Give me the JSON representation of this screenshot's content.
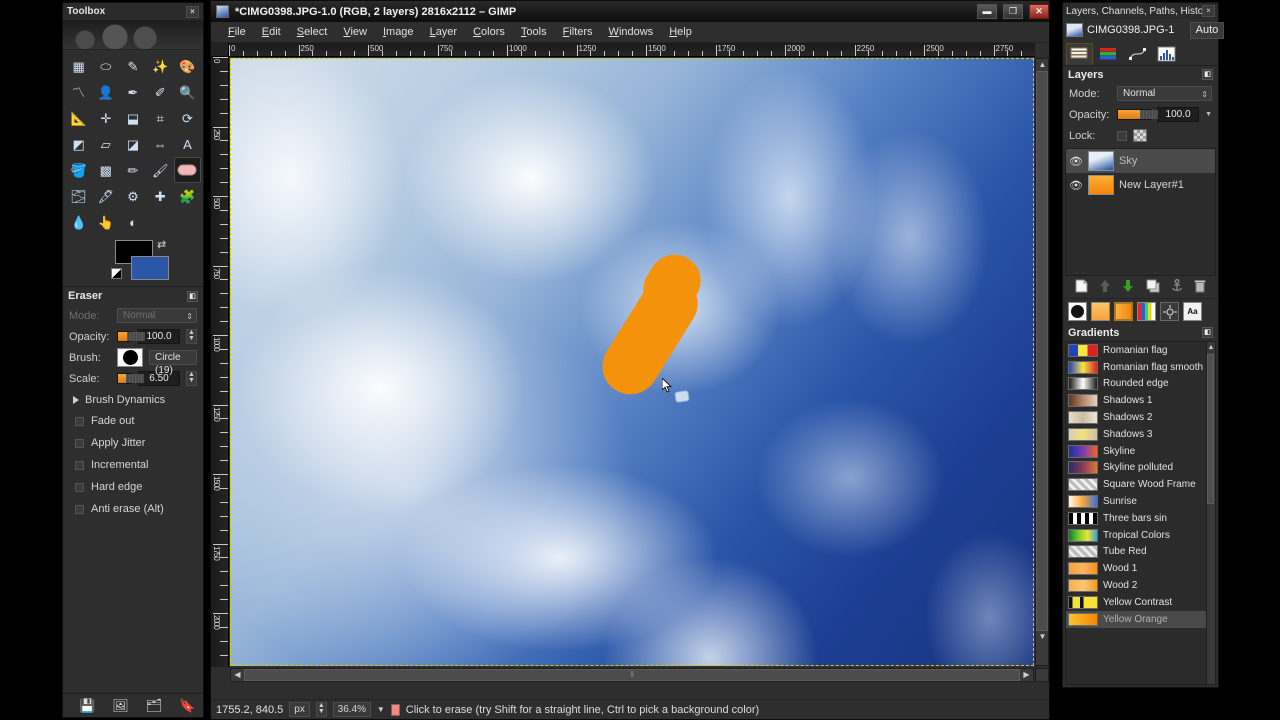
{
  "toolbox": {
    "title": "Toolbox",
    "close_label": "×",
    "tools": [
      {
        "name": "rect-select-tool",
        "label": "Rectangle Select"
      },
      {
        "name": "ellipse-select-tool",
        "label": "Ellipse Select"
      },
      {
        "name": "free-select-tool",
        "label": "Free Select"
      },
      {
        "name": "fuzzy-select-tool",
        "label": "Fuzzy Select"
      },
      {
        "name": "select-by-color-tool",
        "label": "Select by Color"
      },
      {
        "name": "scissors-select-tool",
        "label": "Scissors Select"
      },
      {
        "name": "foreground-select-tool",
        "label": "Foreground Select"
      },
      {
        "name": "paths-tool",
        "label": "Paths"
      },
      {
        "name": "color-picker-tool",
        "label": "Color Picker"
      },
      {
        "name": "zoom-tool",
        "label": "Zoom"
      },
      {
        "name": "measure-tool",
        "label": "Measure"
      },
      {
        "name": "move-tool",
        "label": "Move"
      },
      {
        "name": "align-tool",
        "label": "Alignment"
      },
      {
        "name": "crop-tool",
        "label": "Crop"
      },
      {
        "name": "rotate-tool",
        "label": "Rotate"
      },
      {
        "name": "scale-tool",
        "label": "Scale"
      },
      {
        "name": "shear-tool",
        "label": "Shear"
      },
      {
        "name": "perspective-tool",
        "label": "Perspective"
      },
      {
        "name": "flip-tool",
        "label": "Flip"
      },
      {
        "name": "text-tool",
        "label": "Text"
      },
      {
        "name": "bucket-fill-tool",
        "label": "Bucket Fill"
      },
      {
        "name": "blend-tool",
        "label": "Blend"
      },
      {
        "name": "pencil-tool",
        "label": "Pencil"
      },
      {
        "name": "paintbrush-tool",
        "label": "Paintbrush"
      },
      {
        "name": "eraser-tool",
        "label": "Eraser"
      },
      {
        "name": "airbrush-tool",
        "label": "Airbrush"
      },
      {
        "name": "ink-tool",
        "label": "Ink"
      },
      {
        "name": "clone-tool",
        "label": "Clone"
      },
      {
        "name": "heal-tool",
        "label": "Heal"
      },
      {
        "name": "perspective-clone-tool",
        "label": "Perspective Clone"
      },
      {
        "name": "blur-sharpen-tool",
        "label": "Blur / Sharpen"
      },
      {
        "name": "smudge-tool",
        "label": "Smudge"
      },
      {
        "name": "dodge-burn-tool",
        "label": "Dodge / Burn"
      }
    ],
    "active_tool_index": 24,
    "colors": {
      "foreground": "#000000",
      "background": "#2b57a8"
    },
    "bottom_icons": [
      "save-icon",
      "image-icon",
      "layers-icon",
      "pointer-icon"
    ]
  },
  "tool_options": {
    "title": "Eraser",
    "mode_label": "Mode:",
    "mode_value": "Normal",
    "opacity_label": "Opacity:",
    "opacity_value": "100.0",
    "opacity_percent": 66,
    "brush_label": "Brush:",
    "brush_value": "Circle (19)",
    "scale_label": "Scale:",
    "scale_value": "6.50",
    "scale_percent": 62,
    "brush_dynamics_label": "Brush Dynamics",
    "checkboxes": [
      {
        "label": "Fade out",
        "checked": false
      },
      {
        "label": "Apply Jitter",
        "checked": false
      },
      {
        "label": "Incremental",
        "checked": false
      },
      {
        "label": "Hard edge",
        "checked": false
      },
      {
        "label": "Anti erase  (Alt)",
        "checked": false
      }
    ]
  },
  "image_window": {
    "title": "*CIMG0398.JPG-1.0 (RGB, 2 layers) 2816x2112 – GIMP",
    "window_buttons": {
      "minimize": "▬",
      "maximize": "❐",
      "close": "✕"
    },
    "menu": [
      {
        "label": "File"
      },
      {
        "label": "Edit"
      },
      {
        "label": "Select"
      },
      {
        "label": "View"
      },
      {
        "label": "Image"
      },
      {
        "label": "Layer"
      },
      {
        "label": "Colors"
      },
      {
        "label": "Tools"
      },
      {
        "label": "Filters"
      },
      {
        "label": "Windows"
      },
      {
        "label": "Help"
      }
    ],
    "ruler_h_ticks": [
      "0",
      "250",
      "500",
      "750",
      "1000",
      "1250",
      "1500",
      "1750",
      "2000",
      "2250",
      "2500",
      "2750"
    ],
    "ruler_v_ticks": [
      "0",
      "250",
      "500",
      "750",
      "1000",
      "1250",
      "1500",
      "1750",
      "2000"
    ],
    "statusbar": {
      "position": "1755.2, 840.5",
      "unit": "px",
      "zoom": "36.4%",
      "hint": "Click to erase (try Shift for a straight line, Ctrl to pick a background color)"
    }
  },
  "canvas": {
    "stroke_color": "#f5920b",
    "sky_color": "#1d3f93",
    "cloud_color": "#ffffff",
    "boundary_color": "#d4d000"
  },
  "right_dock": {
    "title": "Layers, Channels, Paths, Histogram - B...",
    "close_label": "×",
    "image_name": "CIMG0398.JPG-1",
    "auto_label": "Auto",
    "tabs": [
      {
        "name": "tab-layers",
        "label": "Layers"
      },
      {
        "name": "tab-channels",
        "label": "Channels"
      },
      {
        "name": "tab-paths",
        "label": "Paths"
      },
      {
        "name": "tab-histogram",
        "label": "Histogram"
      }
    ],
    "active_tab_index": 0,
    "layers_panel": {
      "title": "Layers",
      "mode_label": "Mode:",
      "mode_value": "Normal",
      "opacity_label": "Opacity:",
      "opacity_value": "100.0",
      "opacity_percent": 70,
      "lock_label": "Lock:",
      "layers": [
        {
          "name": "Sky",
          "visible": true,
          "selected": true,
          "thumb": "sky"
        },
        {
          "name": "New Layer#1",
          "visible": true,
          "selected": false,
          "thumb": "orange"
        }
      ],
      "buttons": [
        "new-layer-icon",
        "raise-layer-icon",
        "lower-layer-icon",
        "duplicate-layer-icon",
        "anchor-layer-icon",
        "delete-layer-icon"
      ]
    },
    "brush_row": [
      "brush-swatch",
      "pattern-swatch",
      "gradient-swatch",
      "palette-swatch",
      "dynamics-swatch",
      "font-swatch"
    ],
    "font_label": "Aa",
    "gradients_panel": {
      "title": "Gradients",
      "items": [
        {
          "name": "Romanian flag",
          "css": "linear-gradient(90deg,#1b44c4 0 33%,#f5e642 33% 66%,#d62424 66% 100%)",
          "selected": false
        },
        {
          "name": "Romanian flag smooth",
          "css": "linear-gradient(90deg,#1b44c4,#f5e642,#d62424)",
          "selected": false
        },
        {
          "name": "Rounded edge",
          "css": "linear-gradient(90deg,#1a1a1a,#ffffff,#1a1a1a)",
          "selected": false
        },
        {
          "name": "Shadows 1",
          "css": "linear-gradient(90deg,#5a3720,#b9866a,#e8cfc0)",
          "selected": false
        },
        {
          "name": "Shadows 2",
          "css": "linear-gradient(90deg,#e6dccc,#cbbba4,#efe6d8)",
          "selected": false
        },
        {
          "name": "Shadows 3",
          "css": "linear-gradient(90deg,#d8cdb8,#f0e27a,#cfc0a8)",
          "selected": false
        },
        {
          "name": "Skyline",
          "css": "linear-gradient(90deg,#1b2fa8,#7a3ab0,#e8652a)",
          "selected": false
        },
        {
          "name": "Skyline polluted",
          "css": "linear-gradient(90deg,#2a2a6a,#8a3a5a,#d87a3a)",
          "selected": false
        },
        {
          "name": "Square Wood Frame",
          "css": "repeating-linear-gradient(45deg,#bdbdbd 0 3px,#f2f2f2 3px 6px)",
          "selected": false
        },
        {
          "name": "Sunrise",
          "css": "linear-gradient(90deg,#fff8e0,#f6a63c,#3a6fd0)",
          "selected": false
        },
        {
          "name": "Three bars sin",
          "css": "repeating-linear-gradient(90deg,#000 0 4px,#fff 4px 8px)",
          "selected": false
        },
        {
          "name": "Tropical Colors",
          "css": "linear-gradient(90deg,#0d7a2a,#6fd02a,#f0e23a,#3a9fd0)",
          "selected": false
        },
        {
          "name": "Tube Red",
          "css": "repeating-linear-gradient(45deg,#bdbdbd 0 3px,#ececec 3px 6px)",
          "selected": false
        },
        {
          "name": "Wood 1",
          "css": "linear-gradient(90deg,#f5a23a,#f8b55c,#f39022)",
          "selected": false
        },
        {
          "name": "Wood 2",
          "css": "linear-gradient(90deg,#f6ae48,#fbc777,#f29a2a)",
          "selected": false
        },
        {
          "name": "Yellow Contrast",
          "css": "linear-gradient(90deg,#111 0 12%,#f7e23a 12% 40%,#111 40% 52%,#f7e23a 52% 100%)",
          "selected": false
        },
        {
          "name": "Yellow Orange",
          "css": "linear-gradient(90deg,#fbc02d,#f5860b)",
          "selected": true
        }
      ]
    }
  }
}
